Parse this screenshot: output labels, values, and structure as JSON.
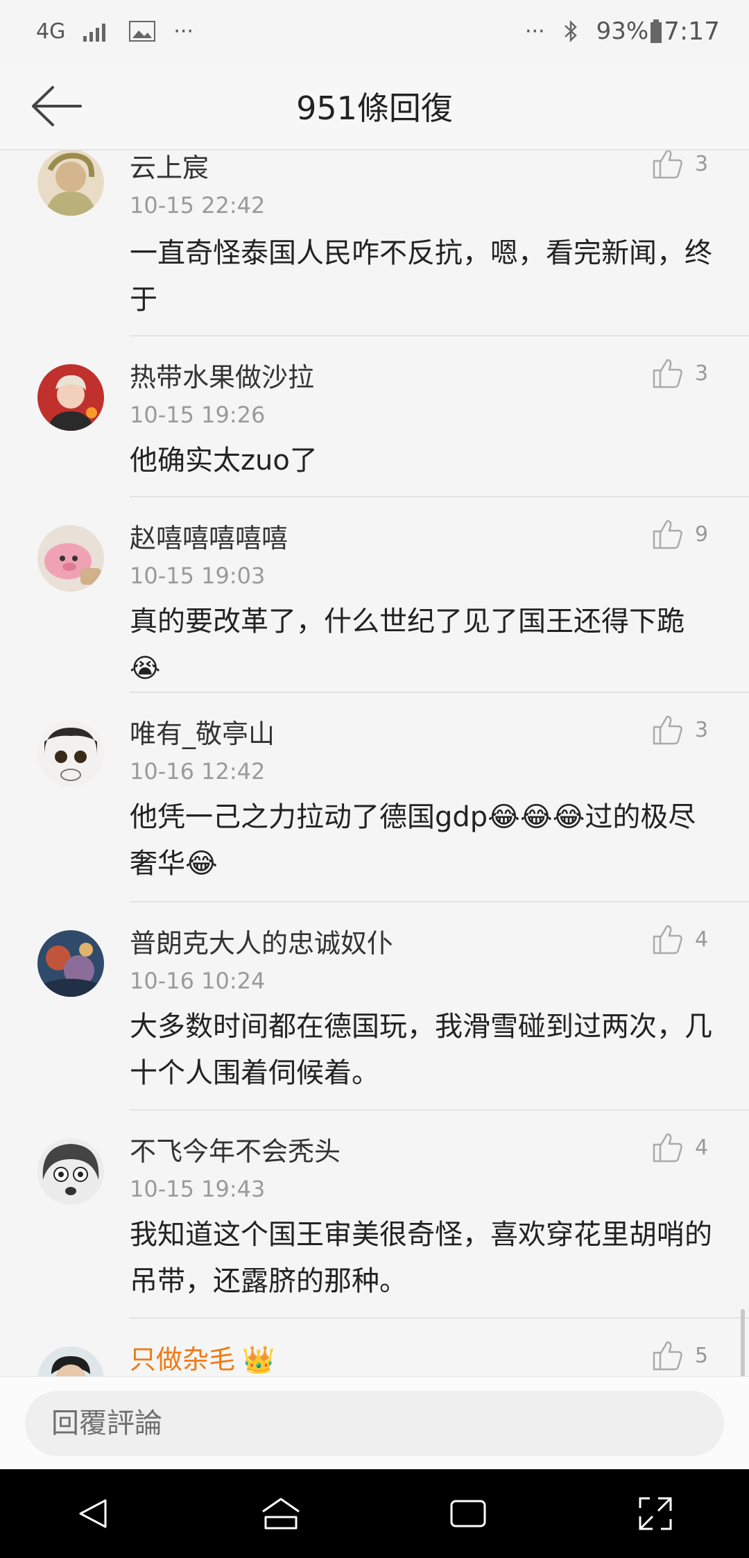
{
  "status_bar": {
    "network": "4G",
    "more_left": "···",
    "more_right": "···",
    "battery": "93%",
    "time": "7:17"
  },
  "header": {
    "title": "951條回復"
  },
  "comments": [
    {
      "username": "云上宸",
      "time": "10-15 22:42",
      "text": "一直奇怪泰国人民咋不反抗，嗯，看完新闻，终于",
      "likes": "3"
    },
    {
      "username": "热带水果做沙拉",
      "time": "10-15 19:26",
      "text": "他确实太zuo了",
      "likes": "3"
    },
    {
      "username": "赵嘻嘻嘻嘻嘻",
      "time": "10-15 19:03",
      "text": "真的要改革了，什么世纪了见了国王还得下跪",
      "emoji": "😭",
      "likes": "9"
    },
    {
      "username": "唯有_敬亭山",
      "time": "10-16 12:42",
      "text": "他凭一己之力拉动了德国gdp😂😂😂过的极尽奢华😂",
      "likes": "3"
    },
    {
      "username": "普朗克大人的忠诚奴仆",
      "time": "10-16 10:24",
      "text": "大多数时间都在德国玩，我滑雪碰到过两次，几十个人围着伺候着。",
      "likes": "4"
    },
    {
      "username": "不飞今年不会秃头",
      "time": "10-15 19:43",
      "text": "我知道这个国王审美很奇怪，喜欢穿花里胡哨的吊带，还露脐的那种。",
      "likes": "4"
    },
    {
      "username": "只做杂毛",
      "badge": "👑",
      "likes": "5"
    }
  ],
  "reply_bar": {
    "placeholder": "回覆評論"
  },
  "colors": {
    "vip_name": "#ef7b15",
    "meta_gray": "#9a9a9a",
    "text": "#222222"
  }
}
